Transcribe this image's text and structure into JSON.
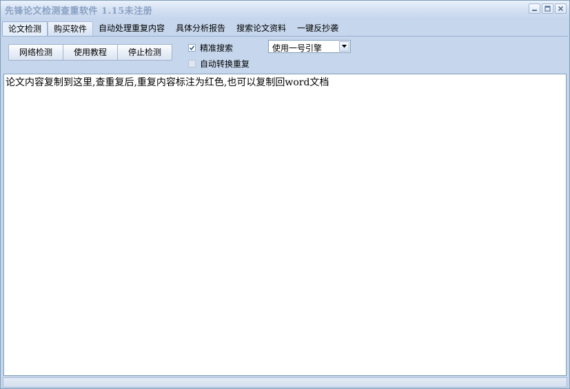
{
  "window": {
    "title": "先锋论文检测查重软件 1.15未注册"
  },
  "tabs": [
    {
      "label": "论文检测",
      "state": "active"
    },
    {
      "label": "购买软件",
      "state": "hover"
    },
    {
      "label": "自动处理重复内容",
      "state": "normal"
    },
    {
      "label": "具体分析报告",
      "state": "normal"
    },
    {
      "label": "搜索论文资料",
      "state": "normal"
    },
    {
      "label": "一键反抄袭",
      "state": "normal"
    }
  ],
  "toolbar": {
    "network_check_label": "网络检测",
    "tutorial_label": "使用教程",
    "stop_check_label": "停止检测"
  },
  "options": {
    "precise_search": {
      "label": "精准搜索",
      "checked": true
    },
    "auto_convert_repeat": {
      "label": "自动转换重复",
      "checked": false,
      "disabled": true
    }
  },
  "engine_select": {
    "selected": "使用一号引擎"
  },
  "editor": {
    "content": "论文内容复制到这里,查重复后,重复内容标注为红色,也可以复制回word文档"
  },
  "statusbar": {
    "text": ""
  },
  "icons": {
    "minimize": "minimize-icon",
    "maximize": "maximize-icon",
    "close": "close-icon",
    "dropdown": "chevron-down-icon",
    "check": "check-icon"
  }
}
